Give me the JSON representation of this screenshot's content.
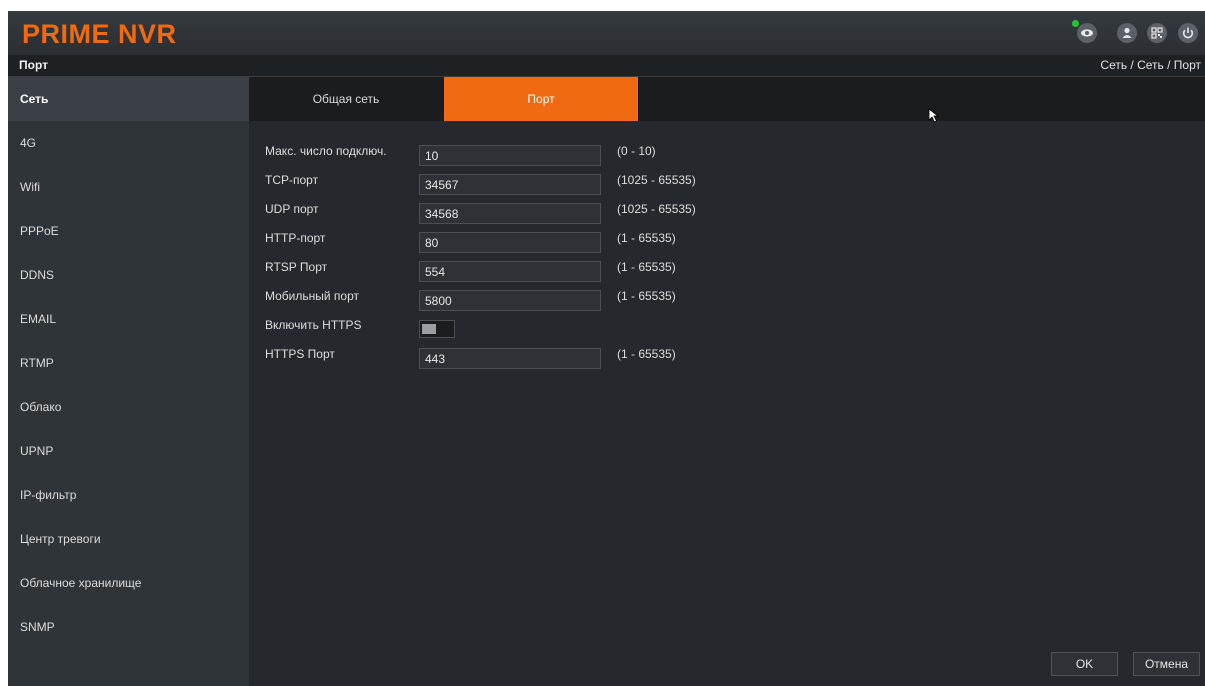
{
  "header": {
    "logo": "PRIME NVR",
    "icons": [
      "eye-icon",
      "user-icon",
      "qr-code-icon",
      "power-icon"
    ],
    "status_color": "#22c438",
    "accent_color": "#f06a12"
  },
  "subheader": {
    "title": "Порт",
    "breadcrumb": "Сеть  / Сеть / Порт"
  },
  "sidebar": {
    "items": [
      {
        "label": "Сеть",
        "active": true
      },
      {
        "label": "4G"
      },
      {
        "label": "Wifi"
      },
      {
        "label": "PPPoE"
      },
      {
        "label": "DDNS"
      },
      {
        "label": "EMAIL"
      },
      {
        "label": "RTMP"
      },
      {
        "label": "Облако"
      },
      {
        "label": "UPNP"
      },
      {
        "label": "IP-фильтр"
      },
      {
        "label": "Центр тревоги"
      },
      {
        "label": "Облачное хранилище"
      },
      {
        "label": "SNMP"
      }
    ]
  },
  "tabs": [
    {
      "label": "Общая сеть",
      "active": false
    },
    {
      "label": "Порт",
      "active": true
    }
  ],
  "form": {
    "max_connections": {
      "label": "Макс. число подключ.",
      "value": "10",
      "range": "(0 - 10)"
    },
    "tcp_port": {
      "label": "TCP-порт",
      "value": "34567",
      "range": "(1025 - 65535)"
    },
    "udp_port": {
      "label": "UDP порт",
      "value": "34568",
      "range": "(1025 - 65535)"
    },
    "http_port": {
      "label": "HTTP-порт",
      "value": "80",
      "range": "(1 - 65535)"
    },
    "rtsp_port": {
      "label": "RTSP Порт",
      "value": "554",
      "range": "(1 - 65535)"
    },
    "mobile_port": {
      "label": "Мобильный порт",
      "value": "5800",
      "range": "(1 - 65535)"
    },
    "https_enable": {
      "label": "Включить HTTPS",
      "enabled": false
    },
    "https_port": {
      "label": "HTTPS Порт",
      "value": "443",
      "range": "(1 - 65535)"
    }
  },
  "footer": {
    "ok_label": "OK",
    "cancel_label": "Отмена"
  }
}
